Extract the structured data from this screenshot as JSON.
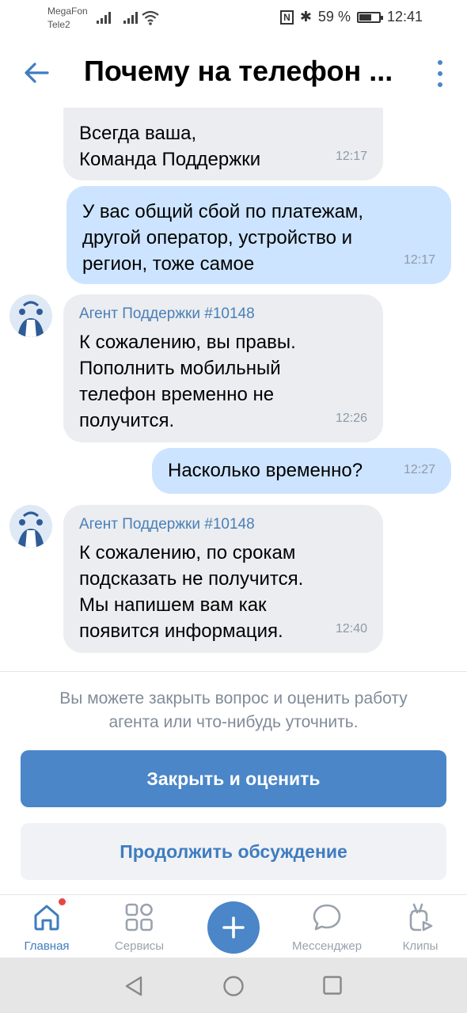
{
  "status": {
    "carrier1": "MegaFon",
    "carrier2": "Tele2",
    "nfc": "N",
    "bt": "✱",
    "battery": "59 %",
    "battery_level": 0.59,
    "time": "12:41"
  },
  "header": {
    "title": "Почему на телефон ...",
    "back_icon": "arrow-left-icon",
    "menu_icon": "more-vertical-icon"
  },
  "messages": [
    {
      "dir": "in",
      "text": "Всегда ваша,\nКоманда Поддержки",
      "time": "12:17"
    },
    {
      "dir": "out",
      "text": "У вас общий сбой по платежам,\nдругой оператор, устройство и\nрегион, тоже самое",
      "time": "12:17"
    },
    {
      "dir": "in",
      "sender": "Агент Поддержки #10148",
      "text": "К сожалению, вы правы.\nПополнить мобильный\nтелефон временно не\nполучится.",
      "time": "12:26"
    },
    {
      "dir": "out",
      "text": "Насколько временно?",
      "time": "12:27"
    },
    {
      "dir": "in",
      "sender": "Агент Поддержки #10148",
      "text": "К сожалению, по срокам\nподсказать не получится.\nМы напишем вам как\nпоявится информация.",
      "time": "12:40"
    }
  ],
  "panel": {
    "hint": "Вы можете закрыть вопрос и оценить работу\nагента или что-нибудь уточнить.",
    "primary_button": "Закрыть и оценить",
    "secondary_button": "Продолжить обсуждение"
  },
  "tabs": [
    {
      "label": "Главная",
      "icon": "home-icon",
      "active": true
    },
    {
      "label": "Сервисы",
      "icon": "services-icon",
      "active": false
    },
    {
      "label": "",
      "icon": "plus-icon",
      "active": false
    },
    {
      "label": "Мессенджер",
      "icon": "chat-bubble-icon",
      "active": false
    },
    {
      "label": "Клипы",
      "icon": "clips-icon",
      "active": false
    }
  ],
  "colors": {
    "accent": "#4a86c8",
    "incoming_bubble": "#ebedf0",
    "outgoing_bubble": "#cce4ff",
    "badge": "#e64646"
  }
}
